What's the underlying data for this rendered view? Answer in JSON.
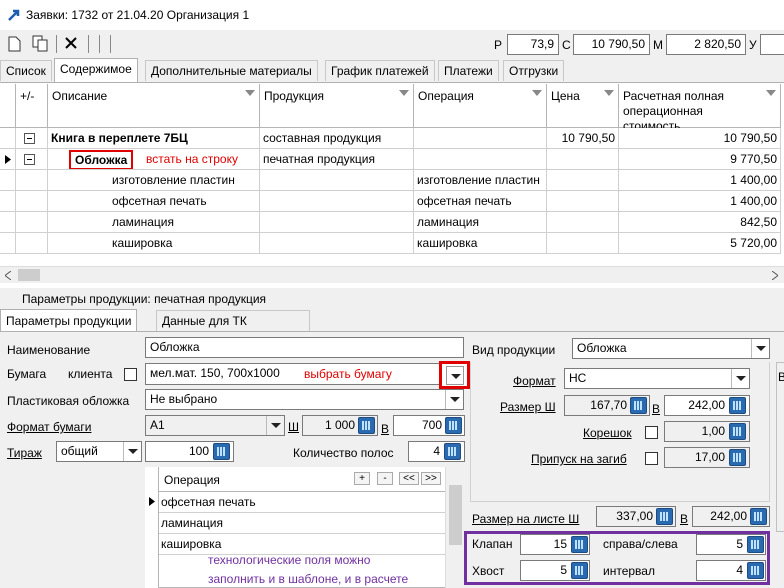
{
  "window": {
    "title": "Заявки: 1732 от 21.04.20  Организация 1"
  },
  "toolbar": {
    "p_label": "P",
    "p_value": "73,9",
    "c_label": "C",
    "c_value": "10 790,50",
    "m_label": "M",
    "m_value": "2 820,50",
    "y_label": "У"
  },
  "tabs": [
    "Список",
    "Содержимое",
    "Дополнительные материалы",
    "График платежей",
    "Платежи",
    "Отгрузки"
  ],
  "grid": {
    "headers": {
      "plusminus": "+/-",
      "description": "Описание",
      "product": "Продукция",
      "operation": "Операция",
      "price": "Цена",
      "cost": "Расчетная полная операционная стоимость"
    },
    "rows": [
      {
        "description": "Книга в переплете 7БЦ",
        "product": "составная продукция",
        "operation": "",
        "price": "10 790,50",
        "cost": "10 790,50"
      },
      {
        "description": "Обложка",
        "product": "печатная продукция",
        "operation": "",
        "price": "",
        "cost": "9 770,50"
      },
      {
        "description": "изготовление пластин",
        "product": "",
        "operation": "изготовление пластин",
        "price": "",
        "cost": "1 400,00"
      },
      {
        "description": "офсетная печать",
        "product": "",
        "operation": "офсетная печать",
        "price": "",
        "cost": "1 400,00"
      },
      {
        "description": "ламинация",
        "product": "",
        "operation": "ламинация",
        "price": "",
        "cost": "842,50"
      },
      {
        "description": "каширoвка",
        "product": "",
        "operation": "кашировка",
        "price": "",
        "cost": "5 720,00"
      }
    ],
    "annotation": "встать на строку"
  },
  "params": {
    "title": "Параметры продукции: печатная продукция",
    "tabs": [
      "Параметры продукции",
      "Данные для ТК"
    ],
    "name_label": "Наименование",
    "name_value": "Обложка",
    "paper_label": "Бумага",
    "client_label": "клиента",
    "paper_value": "мел.мат. 150, 700x1000",
    "paper_annotation": "выбрать бумагу",
    "plastic_label": "Пластиковая обложка",
    "plastic_value": "Не выбрано",
    "format_label": "Формат бумаги",
    "format_value": "A1",
    "format_w_label": "Ш",
    "format_w_value": "1 000",
    "format_h_label": "В",
    "format_h_value": "700",
    "tirazh_label": "Тираж",
    "tirazh_type": "общий",
    "tirazh_value": "100",
    "strips_label": "Количество полос",
    "strips_value": "4",
    "op_header": "Операция",
    "op_buttons": [
      "+",
      "-",
      "<<",
      ">>"
    ],
    "operations": [
      "офсетная печать",
      "ламинация",
      "кашировка"
    ],
    "note_line1": "технологические поля можно",
    "note_line2": "заполнить и в шаблоне, и в  расчете"
  },
  "right": {
    "kind_label": "Вид продукции",
    "kind_value": "Обложка",
    "format_label": "Формат",
    "format_value": "НС",
    "size_w_label": "Размер Ш",
    "size_w_value": "167,70",
    "size_h_label": "В",
    "size_h_value": "242,00",
    "spine_label": "Корешок",
    "spine_value": "1,00",
    "bleed_label": "Припуск на загиб",
    "bleed_value": "17,00",
    "sheet_label": "Размер на листе Ш",
    "sheet_w_value": "337,00",
    "sheet_h_label": "В",
    "sheet_h_value": "242,00",
    "flap_label": "Клапан",
    "flap_value": "15",
    "sides_label": "справа/слева",
    "sides_value": "5",
    "tail_label": "Хвост",
    "tail_value": "5",
    "interval_label": "интервал",
    "interval_value": "4"
  }
}
